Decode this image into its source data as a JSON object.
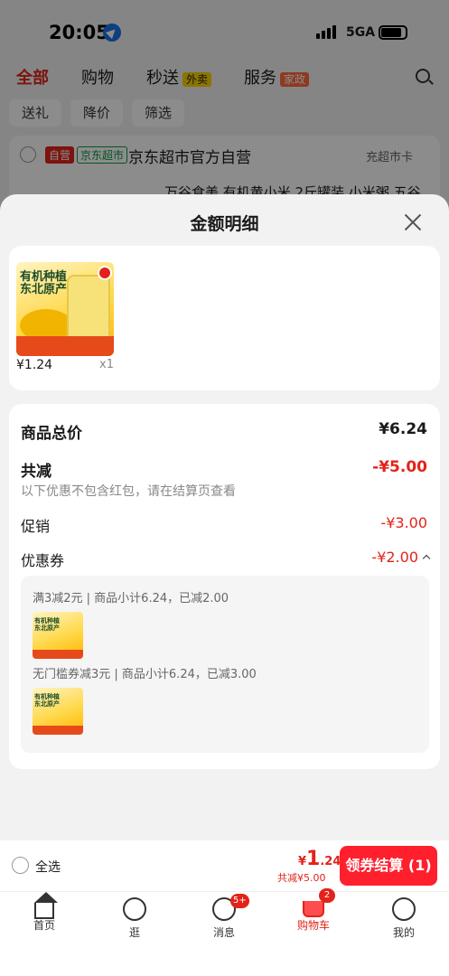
{
  "status_bar": {
    "time": "20:05",
    "network": "5GA"
  },
  "top_tabs": [
    {
      "label": "全部",
      "tag": ""
    },
    {
      "label": "购物",
      "tag": ""
    },
    {
      "label": "秒送",
      "tag": "外卖"
    },
    {
      "label": "服务",
      "tag": "家政"
    }
  ],
  "filters": [
    "送礼",
    "降价",
    "筛选"
  ],
  "store": {
    "tag_self": "自营",
    "tag_market": "京东超市",
    "name": "京东超市官方自营",
    "right": "充超市卡",
    "item_title": "万谷食美 有机黄小米 2斤罐装 小米粥 五谷"
  },
  "sheet": {
    "title": "金额明细",
    "product": {
      "image_text": "有机种植 东北原产",
      "brand": "万谷食美",
      "price": "¥1.24",
      "qty": "x1"
    },
    "summary": {
      "total_label": "商品总价",
      "total_value": "¥6.24",
      "reduce_label": "共减",
      "reduce_value": "-¥5.00",
      "note": "以下优惠不包含红包，请在结算页查看",
      "promo_label": "促销",
      "promo_value": "-¥3.00",
      "coupon_label": "优惠券",
      "coupon_value": "-¥2.00"
    },
    "coupons": [
      {
        "desc": "满3减2元 | 商品小计6.24，已减2.00"
      },
      {
        "desc": "无门槛券减3元 | 商品小计6.24，已减3.00"
      }
    ]
  },
  "checkout": {
    "select_all": "全选",
    "total_currency": "¥",
    "total_int": "1",
    "total_dec": ".24",
    "reduce_text": "共减¥5.00",
    "button": "领券结算 (1)"
  },
  "bottom_nav": [
    {
      "label": "首页",
      "icon": "home-icon"
    },
    {
      "label": "逛",
      "icon": "stroll-icon"
    },
    {
      "label": "消息",
      "icon": "message-icon",
      "badge": "5+"
    },
    {
      "label": "购物车",
      "icon": "cart-icon",
      "badge": "2"
    },
    {
      "label": "我的",
      "icon": "profile-icon"
    }
  ],
  "colors": {
    "accent": "#e2231a",
    "button": "#ff1f2d"
  }
}
